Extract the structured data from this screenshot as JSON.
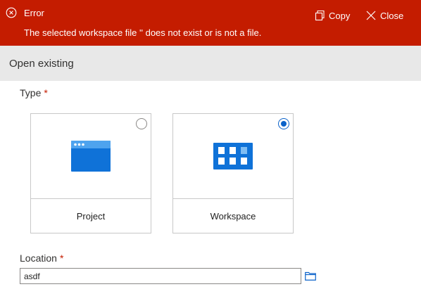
{
  "error_banner": {
    "title": "Error",
    "message": "The selected workspace file '' does not exist or is not a file.",
    "copy_label": "Copy",
    "close_label": "Close",
    "background_color": "#c41c00"
  },
  "section": {
    "title": "Open existing"
  },
  "type_field": {
    "label": "Type",
    "required_marker": "*",
    "options": [
      {
        "label": "Project",
        "icon": "project-window-icon",
        "selected": false
      },
      {
        "label": "Workspace",
        "icon": "workspace-grid-icon",
        "selected": true
      }
    ]
  },
  "location_field": {
    "label": "Location",
    "required_marker": "*",
    "value": "asdf",
    "browse_icon": "folder-icon"
  },
  "colors": {
    "accent": "#0a62c9",
    "required": "#c41c00",
    "icon_blue": "#0f72d8"
  }
}
